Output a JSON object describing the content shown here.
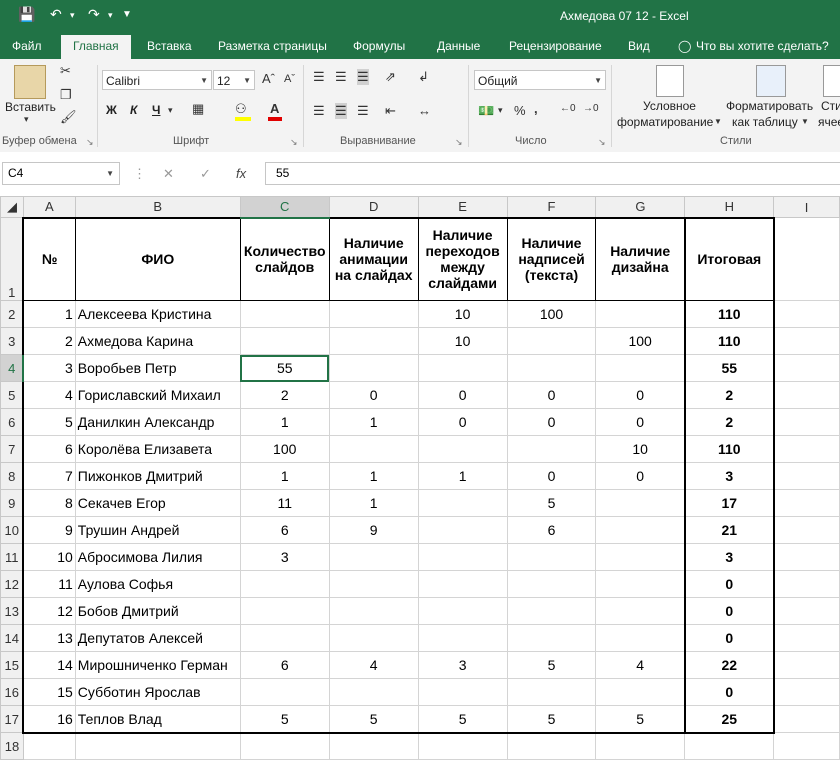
{
  "window": {
    "title": "Ахмедова 07 12 - Excel"
  },
  "tabs": [
    "Файл",
    "Главная",
    "Вставка",
    "Разметка страницы",
    "Формулы",
    "Данные",
    "Рецензирование",
    "Вид"
  ],
  "tell_me": "Что вы хотите сделать?",
  "ribbon": {
    "paste_label": "Вставить",
    "font_name": "Calibri",
    "font_size": "12",
    "bold": "Ж",
    "italic": "К",
    "underline": "Ч",
    "number_format": "Общий",
    "conditional_line1": "Условное",
    "conditional_line2": "форматирование",
    "format_table_line1": "Форматировать",
    "format_table_line2": "как таблицу",
    "styles_line1": "Сти",
    "styles_line2": "ячее",
    "groups": {
      "clipboard": "Буфер обмена",
      "font": "Шрифт",
      "alignment": "Выравнивание",
      "number": "Число",
      "styles": "Стили"
    }
  },
  "formula_bar": {
    "name_box": "C4",
    "value": "55",
    "fx": "fx"
  },
  "columns": [
    "A",
    "B",
    "C",
    "D",
    "E",
    "F",
    "G",
    "H",
    "I"
  ],
  "headers": {
    "num": "№",
    "fio": "ФИО",
    "c": "Количество слайдов",
    "d": "Наличие анимации на слайдах",
    "e": "Наличие переходов между слайдами",
    "f": "Наличие надписей (текста)",
    "g": "Наличие дизайна",
    "h": "Итоговая"
  },
  "rows": [
    {
      "n": "1",
      "name": "Алексеева Кристина",
      "c": "",
      "d": "",
      "e": "10",
      "f": "100",
      "g": "",
      "h": "110"
    },
    {
      "n": "2",
      "name": "Ахмедова Карина",
      "c": "",
      "d": "",
      "e": "10",
      "f": "",
      "g": "100",
      "h": "110"
    },
    {
      "n": "3",
      "name": "Воробьев Петр",
      "c": "55",
      "d": "",
      "e": "",
      "f": "",
      "g": "",
      "h": "55"
    },
    {
      "n": "4",
      "name": "Гориславский Михаил",
      "c": "2",
      "d": "0",
      "e": "0",
      "f": "0",
      "g": "0",
      "h": "2"
    },
    {
      "n": "5",
      "name": "Данилкин Александр",
      "c": "1",
      "d": "1",
      "e": "0",
      "f": "0",
      "g": "0",
      "h": "2"
    },
    {
      "n": "6",
      "name": "Королёва Елизавета",
      "c": "100",
      "d": "",
      "e": "",
      "f": "",
      "g": "10",
      "h": "110"
    },
    {
      "n": "7",
      "name": "Пижонков Дмитрий",
      "c": "1",
      "d": "1",
      "e": "1",
      "f": "0",
      "g": "0",
      "h": "3"
    },
    {
      "n": "8",
      "name": "Секачев Егор",
      "c": "11",
      "d": "1",
      "e": "",
      "f": "5",
      "g": "",
      "h": "17"
    },
    {
      "n": "9",
      "name": "Трушин Андрей",
      "c": "6",
      "d": "9",
      "e": "",
      "f": "6",
      "g": "",
      "h": "21"
    },
    {
      "n": "10",
      "name": "Абросимова Лилия",
      "c": "3",
      "d": "",
      "e": "",
      "f": "",
      "g": "",
      "h": "3"
    },
    {
      "n": "11",
      "name": "Аулова Софья",
      "c": "",
      "d": "",
      "e": "",
      "f": "",
      "g": "",
      "h": "0"
    },
    {
      "n": "12",
      "name": "Бобов Дмитрий",
      "c": "",
      "d": "",
      "e": "",
      "f": "",
      "g": "",
      "h": "0"
    },
    {
      "n": "13",
      "name": "Депутатов Алексей",
      "c": "",
      "d": "",
      "e": "",
      "f": "",
      "g": "",
      "h": "0"
    },
    {
      "n": "14",
      "name": "Мирошниченко Герман",
      "c": "6",
      "d": "4",
      "e": "3",
      "f": "5",
      "g": "4",
      "h": "22"
    },
    {
      "n": "15",
      "name": "Субботин Ярослав",
      "c": "",
      "d": "",
      "e": "",
      "f": "",
      "g": "",
      "h": "0"
    },
    {
      "n": "16",
      "name": "Теплов Влад",
      "c": "5",
      "d": "5",
      "e": "5",
      "f": "5",
      "g": "5",
      "h": "25"
    }
  ],
  "selected_cell": "C4"
}
